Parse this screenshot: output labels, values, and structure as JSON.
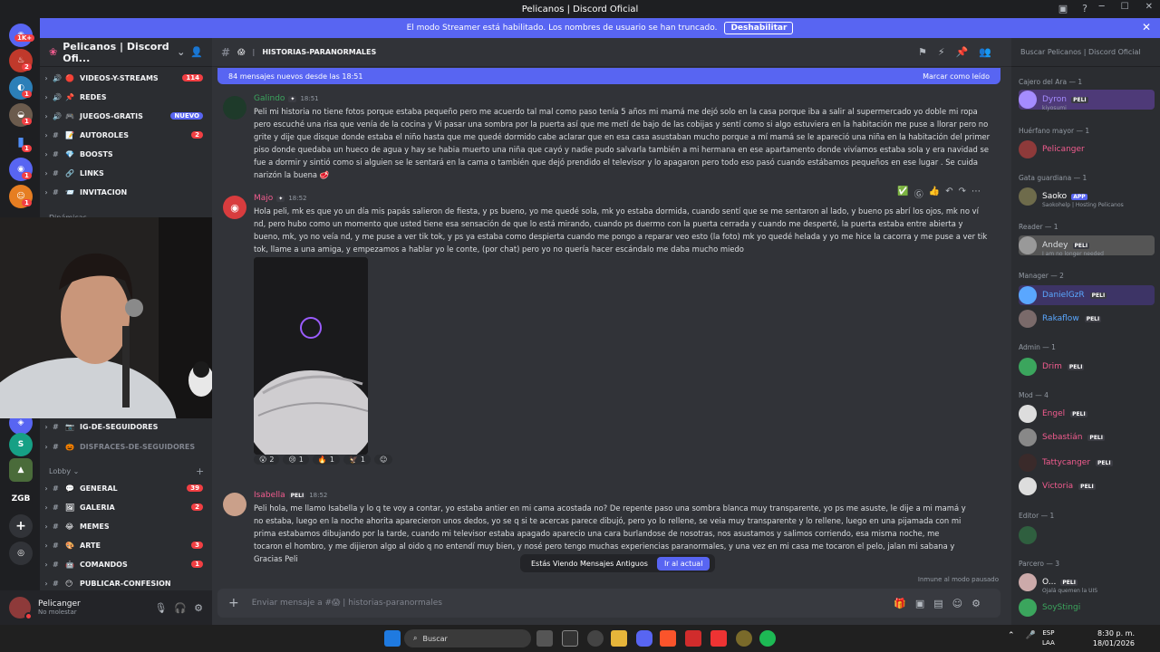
{
  "window": {
    "title": "Pelicanos | Discord Oficial",
    "controls": [
      "─",
      "☐",
      "✕"
    ]
  },
  "banner": {
    "text": "El modo Streamer está habilitado. Los nombres de usuario se han truncado.",
    "button": "Deshabilitar"
  },
  "servers": {
    "home_badge": "1K+",
    "badges": [
      "2",
      "1",
      "1",
      "1",
      "1",
      "1"
    ],
    "label_zgb": "ZGB",
    "label_s": "S"
  },
  "sidebar": {
    "server_name": "Pelicanos | Discord Ofi...",
    "channels": [
      {
        "name": "videos-y-streams",
        "emoji": "🔴",
        "badge": "114"
      },
      {
        "name": "redes",
        "emoji": "📌",
        "badge": ""
      },
      {
        "name": "juegos-gratis",
        "emoji": "🎮",
        "badge": "NUEVO"
      },
      {
        "name": "autoroles",
        "emoji": "📝",
        "badge": "2"
      },
      {
        "name": "boosts",
        "emoji": "💎",
        "badge": ""
      },
      {
        "name": "links",
        "emoji": "🔗",
        "badge": ""
      },
      {
        "name": "invitacion",
        "emoji": "📨",
        "badge": ""
      }
    ],
    "category_dinamicas": "Dinámicas",
    "channels2": [
      {
        "name": "ig-de-seguidores",
        "emoji": "📷",
        "badge": ""
      },
      {
        "name": "disfraces-de-seguidores",
        "emoji": "🎃",
        "badge": ""
      }
    ],
    "category_lobby": "Lobby",
    "channels3": [
      {
        "name": "general",
        "emoji": "💬",
        "badge": "39"
      },
      {
        "name": "galeria",
        "emoji": "🖼",
        "badge": "2"
      },
      {
        "name": "memes",
        "emoji": "😂",
        "badge": ""
      },
      {
        "name": "arte",
        "emoji": "🎨",
        "badge": "3"
      },
      {
        "name": "comandos",
        "emoji": "🤖",
        "badge": "1"
      },
      {
        "name": "publicar-confesion",
        "emoji": "😶",
        "badge": ""
      }
    ]
  },
  "user": {
    "name": "Pelicanger",
    "status": "No molestar"
  },
  "channel": {
    "name": "historias-paranormales",
    "emoji": "😱",
    "new_messages": "84 mensajes nuevos desde las 18:51",
    "mark_read": "Marcar como leído"
  },
  "messages": [
    {
      "author": "Galindo",
      "time": "18:51",
      "text": "Peli mi historia no tiene fotos porque estaba pequeño pero me acuerdo tal mal como paso tenía 5 años mi mamá me dejó solo en la casa porque iba a salir al supermercado yo doble mi ropa pero escuché una risa que venía de la cocina y Vi pasar una sombra por la puerta así que me metí de bajo de las cobijas y sentí como si algo estuviera en la habitación me puse a llorar pero no grite y dije que disque donde estaba el niño hasta que me quedé dormido cabe aclarar que en esa casa asustaban mucho porque a mí mamá se le apareció una niña en la habitación del primer piso donde quedaba un hueco de agua y hay se habia muerto una niña que cayó y nadie pudo salvarla también a mi hermana en ese apartamento donde vivíamos estaba sola y era navidad se fue a dormir y sintió como si alguien se le sentará en la cama o también que dejó prendido el televisor y lo apagaron pero todo eso pasó cuando estábamos pequeños en ese lugar . Se cuida narizón la buena 🥩"
    },
    {
      "author": "Majo",
      "time": "18:52",
      "text": "Hola peli, mk es que yo un día mis papás salieron de fiesta, y ps bueno, yo me quedé sola, mk yo estaba dormida, cuando sentí que se me sentaron al lado, y bueno ps abrí los ojos, mk no ví nd, pero hubo como un momento que usted tiene esa sensación de que lo está mirando, cuando ps duermo con la puerta cerrada y cuando me desperté, la puerta estaba entre abierta y bueno, mk, yo no veía nd, y me puse a ver tik tok, y ps ya estaba como despierta cuando me pongo a reparar veo esto (la foto) mk yo quedé helada y yo me hice la cacorra y me puse a ver tik tok, llame a una amiga, y empezamos a hablar yo le conte, (por chat) pero yo no quería hacer escándalo me daba mucho miedo",
      "reactions": [
        {
          "emoji": "😮",
          "count": "2"
        },
        {
          "emoji": "😢",
          "count": "1"
        },
        {
          "emoji": "🔥",
          "count": "1"
        },
        {
          "emoji": "🦅",
          "count": "1"
        }
      ]
    },
    {
      "author": "Isabella",
      "time": "18:52",
      "text": "Peli hola, me llamo Isabella y lo q te voy a contar, yo estaba antier en mi cama acostada no? De repente paso una sombra blanca muy transparente, yo ps me asuste, le dije a mi mamá y no estaba, luego en la noche ahorita aparecieron unos dedos, yo se q si te acercas parece dibujó, pero yo lo rellene, se veia muy transparente y lo rellene, luego en una pijamada con mi prima estabamos dibujando por la tarde, cuando mi televisor estaba apagado aparecio una cara burlandose de nosotras, nos asustamos y salimos corriendo, esa misma noche, me tocaron el hombro, y me dijieron algo al oido q no entendí muy bien, y nosé pero tengo muchas experiencias paranormales,  y una vez en mi casa me tocaron el pelo, jalan mi sabana y veo dedos.",
      "extra": "Gracias Peli"
    }
  ],
  "old_messages": {
    "text": "Estás Viendo Mensajes Antiguos",
    "button": "Ir al actual"
  },
  "immune": "Inmune al modo pausado",
  "input_placeholder": "Enviar mensaje a #😱 | historias-paranormales",
  "members": {
    "search": "Buscar Pelicanos | Discord Oficial",
    "groups": [
      {
        "role": "Cajero del Ara — 1",
        "members": [
          {
            "name": "Dyron",
            "sub": "kiyosumi",
            "color": "#a58cff",
            "tag": "PELI"
          }
        ]
      },
      {
        "role": "Huérfano mayor — 1",
        "members": [
          {
            "name": "Pelicanger",
            "sub": "",
            "color": "#f25c8f",
            "tag": ""
          }
        ]
      },
      {
        "role": "Gata guardiana — 1",
        "members": [
          {
            "name": "Saoko",
            "sub": "Saokohelp | Hosting Pelicanos",
            "color": "#ffffff",
            "tag": "APP"
          }
        ]
      },
      {
        "role": "Reader — 1",
        "members": [
          {
            "name": "Andey",
            "sub": "I am no longer needed",
            "color": "#dbdee1",
            "tag": "PELI"
          }
        ]
      },
      {
        "role": "Manager — 2",
        "members": [
          {
            "name": "DanielGzR",
            "sub": "",
            "color": "#5aa7ff",
            "tag": "PELI"
          },
          {
            "name": "Rakaflow",
            "sub": "",
            "color": "#5aa7ff",
            "tag": "PELI"
          }
        ]
      },
      {
        "role": "Admin — 1",
        "members": [
          {
            "name": "Drim",
            "sub": "",
            "color": "#f25c8f",
            "tag": "PELI"
          }
        ]
      },
      {
        "role": "Mod — 4",
        "members": [
          {
            "name": "Engel",
            "sub": "",
            "color": "#f25c8f",
            "tag": "PELI"
          },
          {
            "name": "Sebastián",
            "sub": "",
            "color": "#f25c8f",
            "tag": "PELI"
          },
          {
            "name": "Tattycanger",
            "sub": "",
            "color": "#f25c8f",
            "tag": "PELI"
          },
          {
            "name": "Victoria",
            "sub": "",
            "color": "#f25c8f",
            "tag": "PELI"
          }
        ]
      },
      {
        "role": "Editor — 1",
        "members": [
          {
            "name": "",
            "sub": "",
            "color": "#dbdee1",
            "tag": ""
          }
        ]
      },
      {
        "role": "Parcero — 3",
        "members": [
          {
            "name": "O...",
            "sub": "Ojalá quemen la UIS",
            "color": "#ffffff",
            "tag": "PELI"
          },
          {
            "name": "SoyStingi",
            "sub": "",
            "color": "#3ba55d",
            "tag": ""
          }
        ]
      }
    ]
  },
  "taskbar": {
    "search": "Buscar",
    "lang": "ESP",
    "lang2": "LAA",
    "time": "8:30 p. m.",
    "date": "18/01/2026"
  },
  "colors": {
    "accent": "#5865f2",
    "bg_main": "#313338",
    "bg_side": "#2b2d31",
    "badge": "#f23f43"
  }
}
